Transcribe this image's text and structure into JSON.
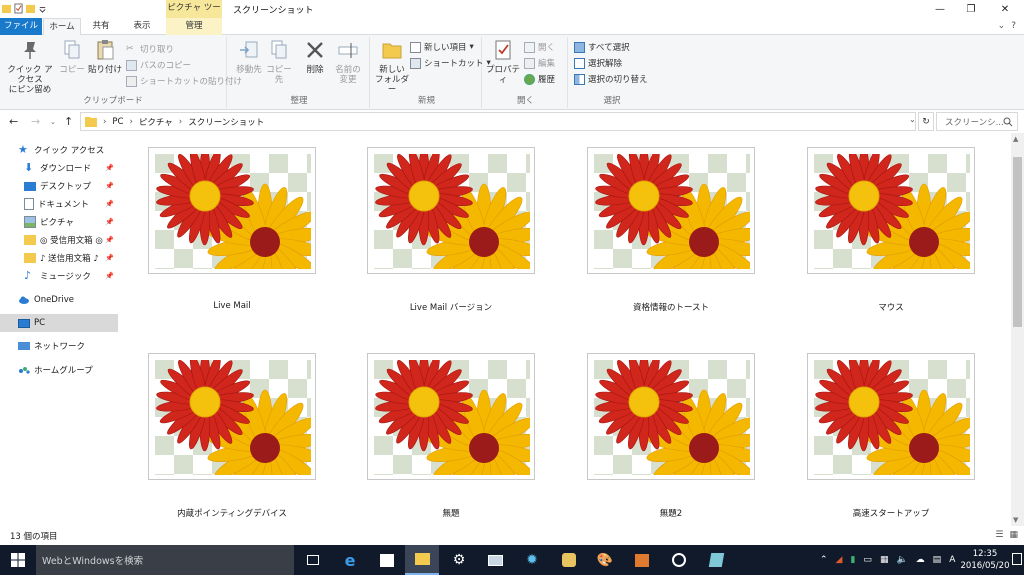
{
  "window": {
    "context_tab": "ピクチャ ツール",
    "title": "スクリーンショット",
    "minimize_glyph": "—",
    "maximize_glyph": "❐",
    "close_glyph": "✕"
  },
  "ribbon_tabs": {
    "file": "ファイル",
    "home": "ホーム",
    "share": "共有",
    "view": "表示",
    "manage": "管理",
    "collapse_glyph": "⌄",
    "help_glyph": "?"
  },
  "ribbon": {
    "clipboard": {
      "label": "クリップボード",
      "pin_quick_access": "クイック アクセス\nにピン留め",
      "copy": "コピー",
      "paste": "貼り付け",
      "cut": "切り取り",
      "copy_path": "パスのコピー",
      "paste_shortcut": "ショートカットの貼り付け"
    },
    "organize": {
      "label": "整理",
      "move_to": "移動先",
      "copy_to": "コピー先",
      "delete": "削除",
      "rename": "名前の\n変更"
    },
    "new": {
      "label": "新規",
      "new_folder": "新しい\nフォルダー",
      "new_item": "新しい項目",
      "shortcut": "ショートカット"
    },
    "open": {
      "label": "開く",
      "properties": "プロパティ",
      "open": "開く",
      "edit": "編集",
      "history": "履歴"
    },
    "select": {
      "label": "選択",
      "select_all": "すべて選択",
      "select_none": "選択解除",
      "invert": "選択の切り替え"
    }
  },
  "address": {
    "breadcrumb": [
      "PC",
      "ピクチャ",
      "スクリーンショット"
    ],
    "search_placeholder": "スクリーンシ..."
  },
  "nav": {
    "quick_access": "クイック アクセス",
    "items": [
      {
        "label": "ダウンロード",
        "pinned": true
      },
      {
        "label": "デスクトップ",
        "pinned": true
      },
      {
        "label": "ドキュメント",
        "pinned": true
      },
      {
        "label": "ピクチャ",
        "pinned": true
      },
      {
        "label": "◎ 受信用文箱 ◎",
        "pinned": true
      },
      {
        "label": "♪ 送信用文箱 ♪",
        "pinned": true
      },
      {
        "label": "ミュージック",
        "pinned": true
      }
    ],
    "onedrive": "OneDrive",
    "pc": "PC",
    "network": "ネットワーク",
    "homegroup": "ホームグループ"
  },
  "files": [
    {
      "name": "Live Mail"
    },
    {
      "name": "Live Mail バージョン"
    },
    {
      "name": "資格情報のトースト"
    },
    {
      "name": "マウス"
    },
    {
      "name": "内蔵ポインティングデバイス"
    },
    {
      "name": "無題"
    },
    {
      "name": "無題2"
    },
    {
      "name": "高速スタートアップ"
    }
  ],
  "status": {
    "item_count": "13 個の項目"
  },
  "taskbar": {
    "search_placeholder": "WebとWindowsを検索",
    "ime": "A",
    "time": "12:35",
    "date": "2016/05/20"
  },
  "colors": {
    "accent": "#1979ca",
    "context_tab": "#f6e79a",
    "taskbar": "#101a2a",
    "flower_red": "#d1261c",
    "flower_yellow": "#f5b800",
    "checker": "#d7e0cf"
  }
}
